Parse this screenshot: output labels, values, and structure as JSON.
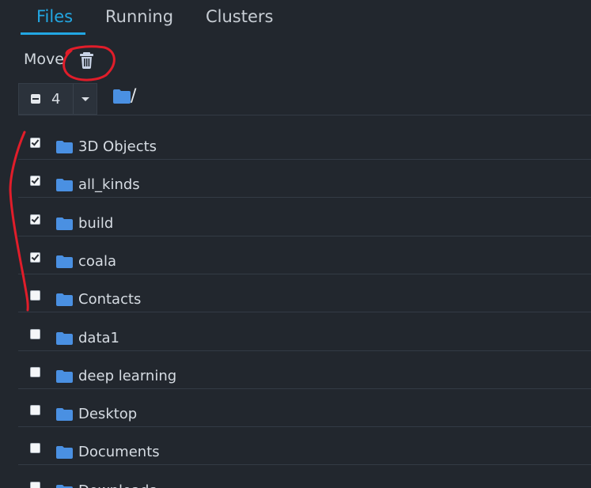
{
  "tabs": [
    {
      "label": "Files"
    },
    {
      "label": "Running"
    },
    {
      "label": "Clusters"
    }
  ],
  "toolbar": {
    "move_label": "Move",
    "delete_icon": "trash-icon"
  },
  "selection": {
    "count": "4",
    "state_icon": "minus-square-icon"
  },
  "breadcrumb": {
    "separator": "/"
  },
  "files": [
    {
      "name": "3D Objects",
      "checked": true
    },
    {
      "name": "all_kinds",
      "checked": true
    },
    {
      "name": "build",
      "checked": true
    },
    {
      "name": "coala",
      "checked": true
    },
    {
      "name": "Contacts",
      "checked": false
    },
    {
      "name": "data1",
      "checked": false
    },
    {
      "name": "deep learning",
      "checked": false
    },
    {
      "name": "Desktop",
      "checked": false
    },
    {
      "name": "Documents",
      "checked": false
    },
    {
      "name": "Downloads",
      "checked": false
    }
  ],
  "colors": {
    "background": "#22272e",
    "accent": "#22a7e3",
    "folder": "#4a90e2",
    "annotation": "#e11d2a"
  }
}
